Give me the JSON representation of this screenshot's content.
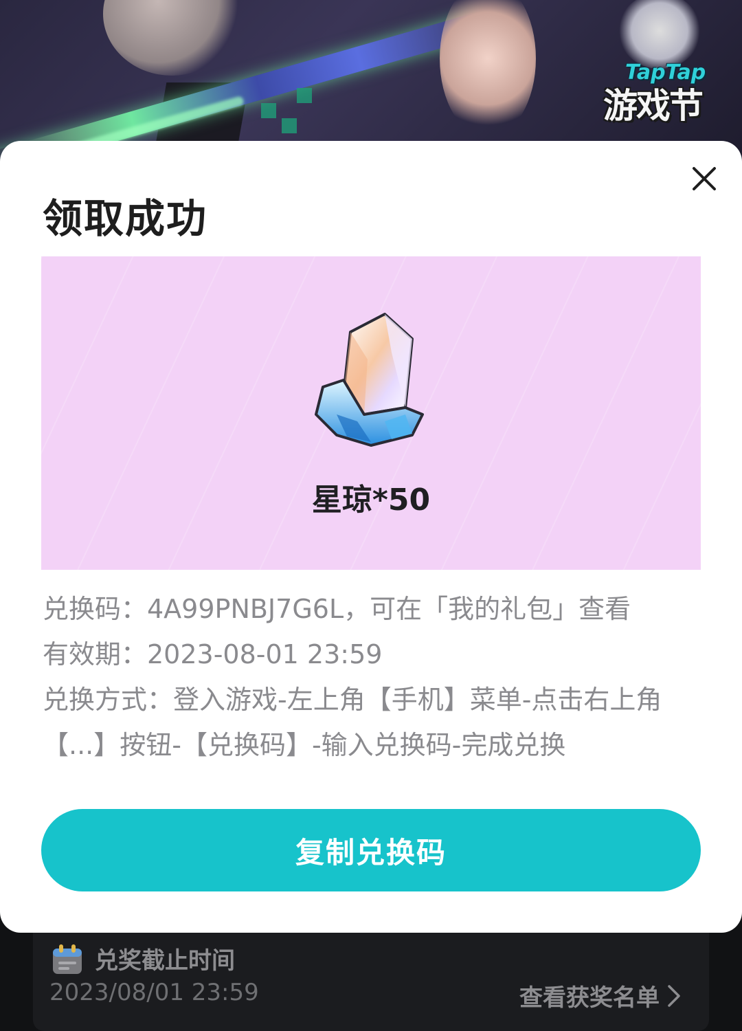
{
  "background": {
    "logo_en": "TapTap",
    "logo_cn": "游戏节"
  },
  "modal": {
    "title": "领取成功",
    "close_icon": "close-icon",
    "reward": {
      "icon": "crystal-icon",
      "name": "星琼*50"
    },
    "info": {
      "code_line": "兑换码：4A99PNBJ7G6L，可在「我的礼包」查看",
      "validity_line": "有效期：2023-08-01 23:59",
      "method_line": "兑换方式：登入游戏-左上角【手机】菜单-点击右上角【...】按钮-【兑换码】-输入兑换码-完成兑换"
    },
    "copy_button_label": "复制兑换码"
  },
  "under_panel": {
    "deadline_label": "兑奖截止时间",
    "deadline_value": "2023/08/01 23:59",
    "winners_link": "查看获奖名单"
  },
  "colors": {
    "accent": "#17c3cb",
    "reward_bg": "#f3d2f7",
    "text_dark": "#1e1e1e",
    "text_muted": "#8a8a8e"
  }
}
